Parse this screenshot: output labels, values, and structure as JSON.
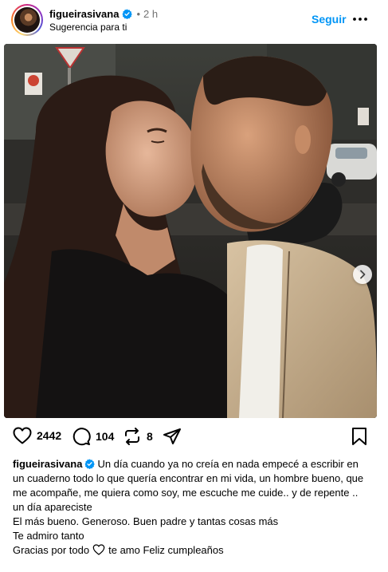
{
  "header": {
    "username": "figueirasivana",
    "time": "2 h",
    "subtitle": "Sugerencia para ti",
    "follow_label": "Seguir",
    "more_icon": "more-horizontal-icon"
  },
  "photo": {
    "alt": "Couple kissing selfie",
    "slide_count": 13,
    "active_slide": 1
  },
  "actions": {
    "likes": "2442",
    "comments": "104",
    "reposts": "8"
  },
  "caption": {
    "username": "figueirasivana",
    "line1": "Un día cuando ya no creía en nada empecé a escribir en un cuaderno todo lo que quería encontrar en mi vida, un hombre bueno, que me acompañe, me quiera como soy, me escuche me cuide.. y de repente .. un día apareciste",
    "line2": "El más bueno. Generoso. Buen padre y tantas cosas más",
    "line3": "Te admiro tanto",
    "line4_start": "Gracias por todo",
    "line4_end": "te amo Feliz cumpleaños"
  },
  "colors": {
    "accent": "#0095f6",
    "muted": "#737373"
  }
}
